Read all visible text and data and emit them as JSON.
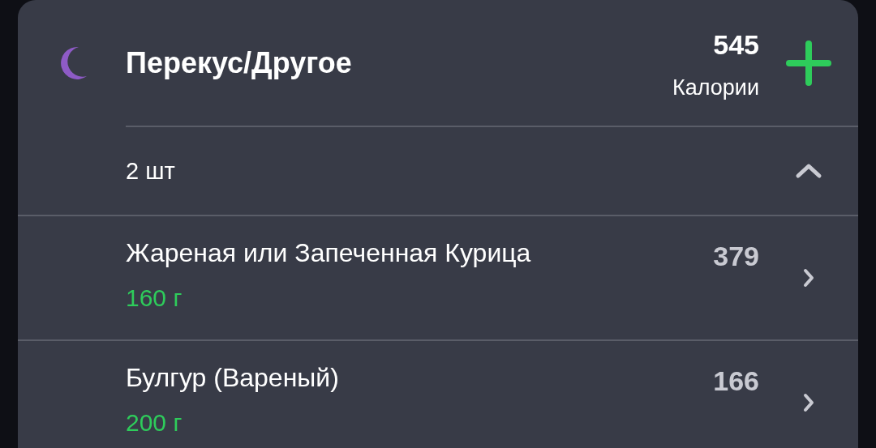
{
  "section": {
    "title": "Перекус/Другое",
    "calories": "545",
    "calories_label": "Калории"
  },
  "summary": {
    "count": "2 шт",
    "expanded": true
  },
  "items": [
    {
      "name": "Жареная или Запеченная Курица",
      "amount": "160 г",
      "calories": "379"
    },
    {
      "name": "Булгур (Вареный)",
      "amount": "200 г",
      "calories": "166"
    }
  ]
}
